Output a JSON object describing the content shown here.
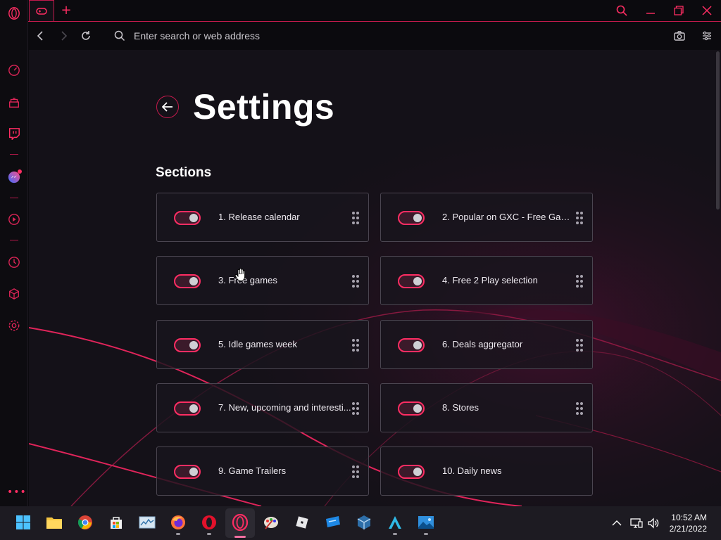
{
  "colors": {
    "accent": "#ff2d63",
    "accent_dark": "#c21a4c",
    "background": "#141118"
  },
  "address_bar": {
    "placeholder": "Enter search or web address"
  },
  "page": {
    "title": "Settings",
    "section_heading": "Sections"
  },
  "sections": [
    {
      "label": "1. Release calendar",
      "enabled": true
    },
    {
      "label": "2. Popular on GXC - Free Game...",
      "enabled": true
    },
    {
      "label": "3. Free games",
      "enabled": true
    },
    {
      "label": "4. Free 2 Play selection",
      "enabled": true
    },
    {
      "label": "5. Idle games week",
      "enabled": true
    },
    {
      "label": "6. Deals aggregator",
      "enabled": true
    },
    {
      "label": "7. New, upcoming and interesti...",
      "enabled": true
    },
    {
      "label": "8. Stores",
      "enabled": true
    },
    {
      "label": "9. Game Trailers",
      "enabled": true
    },
    {
      "label": "10. Daily news",
      "enabled": true
    }
  ],
  "sidebar": {
    "icons": [
      "opera-gx-logo-icon",
      "speedometer-icon",
      "gx-store-icon",
      "twitch-icon",
      "messenger-icon",
      "player-icon",
      "history-icon",
      "cube-extensions-icon",
      "settings-gear-icon"
    ],
    "more_label": "•••"
  },
  "taskbar": {
    "apps": [
      "windows-start-icon",
      "file-explorer-icon",
      "chrome-icon",
      "microsoft-store-icon",
      "task-manager-icon",
      "firefox-icon",
      "opera-icon",
      "opera-gx-icon",
      "paint-icon",
      "roblox-icon",
      "remote-desktop-icon",
      "virtualbox-icon",
      "arma-icon",
      "photos-icon"
    ],
    "clock": {
      "time": "10:52 AM",
      "date": "2/21/2022"
    }
  }
}
